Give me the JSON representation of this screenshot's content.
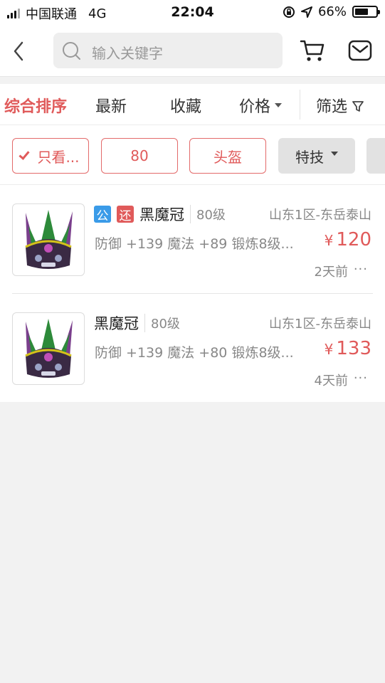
{
  "status": {
    "carrier": "中国联通",
    "network": "4G",
    "time": "22:04",
    "battery": "66%",
    "battery_level": 0.66
  },
  "search": {
    "placeholder": "输入关键字"
  },
  "sort_tabs": [
    "综合排序",
    "最新",
    "收藏",
    "价格",
    "筛选"
  ],
  "filters": [
    "只看...",
    "80",
    "头盔",
    "特技"
  ],
  "items": [
    {
      "tags": [
        "公",
        "还"
      ],
      "name": "黑魔冠",
      "level": "80级",
      "server": "山东1区-东岳泰山",
      "stats": "防御 +139 魔法 +89 锻炼8级...",
      "currency": "¥",
      "price": "120",
      "time": "2天前",
      "more": "···"
    },
    {
      "tags": [],
      "name": "黑魔冠",
      "level": "80级",
      "server": "山东1区-东岳泰山",
      "stats": "防御 +139 魔法 +80 锻炼8级...",
      "currency": "¥",
      "price": "133",
      "time": "4天前",
      "more": "···"
    }
  ],
  "colors": {
    "accent": "#e05a5a",
    "tag_blue": "#3a9be8"
  }
}
